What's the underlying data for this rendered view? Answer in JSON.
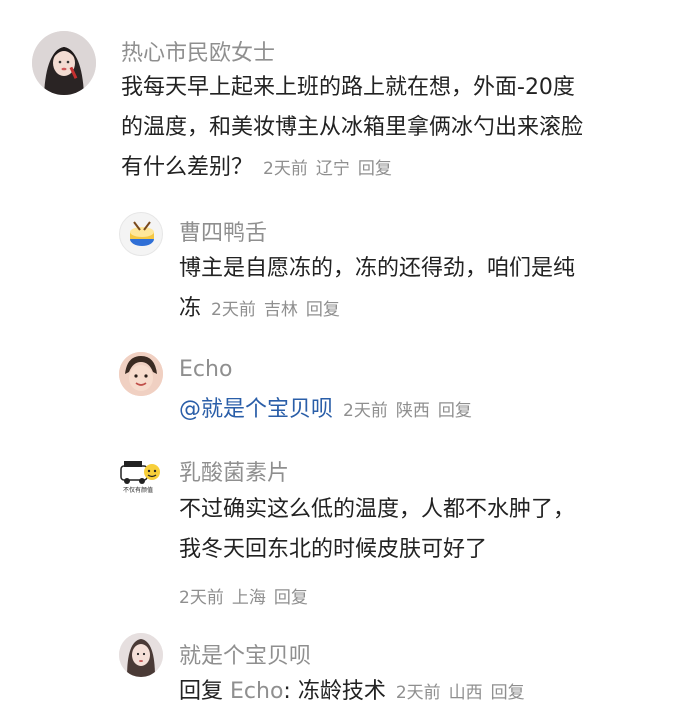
{
  "comments": [
    {
      "author": "热心市民欧女士",
      "lines": [
        "我每天早上起来上班的路上就在想，外面-20度",
        "的温度，和美妆博主从冰箱里拿俩冰勺出来滚脸",
        "有什么差别？"
      ],
      "time": "2天前",
      "location": "辽宁",
      "reply_label": "回复"
    },
    {
      "author": "曹四鸭舌",
      "lines": [
        "博主是自愿冻的，冻的还得劲，咱们是纯",
        "冻"
      ],
      "time": "2天前",
      "location": "吉林",
      "reply_label": "回复"
    },
    {
      "author": "Echo",
      "mention": "@就是个宝贝呗",
      "time": "2天前",
      "location": "陕西",
      "reply_label": "回复"
    },
    {
      "author": "乳酸菌素片",
      "lines": [
        "不过确实这么低的温度，人都不水肿了，",
        "我冬天回东北的时候皮肤可好了"
      ],
      "time": "2天前",
      "location": "上海",
      "reply_label": "回复"
    },
    {
      "author": "就是个宝贝呗",
      "reply_prefix": "回复",
      "reply_target": "Echo",
      "text": ": 冻龄技术",
      "time": "2天前",
      "location": "山西",
      "reply_label": "回复"
    }
  ],
  "avatar_badge_text": "不仅有颜值",
  "colors": {
    "text": "#222222",
    "meta": "#8f8f8f",
    "mention": "#2a5ea8"
  }
}
